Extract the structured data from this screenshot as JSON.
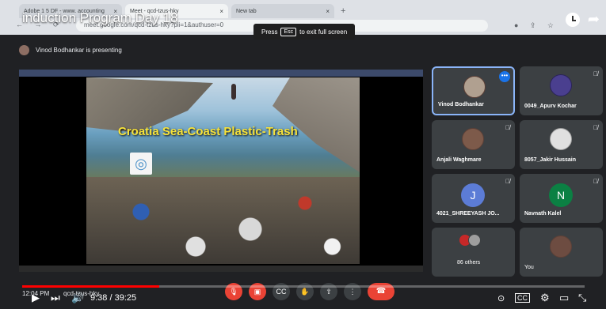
{
  "browser": {
    "tabs": [
      {
        "label": "Adobe 1 5 DF - www.  accounting",
        "active": false
      },
      {
        "label": "Meet - qcd-tzus-hky",
        "active": true
      },
      {
        "label": "New tab",
        "active": false
      }
    ],
    "url": "meet.google.com/qcd-tzus-hky?pli=1&authuser=0"
  },
  "youtube": {
    "video_title": "induction Program Day 18",
    "current_time": "9:38",
    "duration": "39:25",
    "time_display": "9:38 / 39:25",
    "progress_fraction": 0.244,
    "fullscreen_hint": {
      "press": "Press",
      "key": "Esc",
      "rest": "to exit full screen"
    }
  },
  "meet": {
    "presenting_text": "Vinod Bodhankar is presenting",
    "clock": "12:04 PM",
    "meeting_code": "qcd-tzus-hky",
    "slide_title": "Croatia Sea-Coast Plastic-Trash",
    "participants": [
      {
        "name": "Vinod Bodhankar",
        "kind": "photo",
        "active": true
      },
      {
        "name": "0049_Apurv Kochar",
        "kind": "photo",
        "muted": true
      },
      {
        "name": "Anjali Waghmare",
        "kind": "photo",
        "muted": true
      },
      {
        "name": "8057_Jakir Hussain",
        "kind": "photo",
        "muted": true
      },
      {
        "name": "4021_SHREEYASH JO...",
        "kind": "initial",
        "initial": "J",
        "color": "#5c7cd6",
        "muted": true
      },
      {
        "name": "Navnath Kalel",
        "kind": "initial",
        "initial": "N",
        "color": "#0b8043",
        "muted": true
      },
      {
        "name": "86 others",
        "kind": "group",
        "muted": true
      },
      {
        "name": "You",
        "kind": "photo"
      }
    ]
  },
  "colors": {
    "accent": "#8ab4f8",
    "danger": "#ea4335",
    "progress": "#ff0000"
  }
}
